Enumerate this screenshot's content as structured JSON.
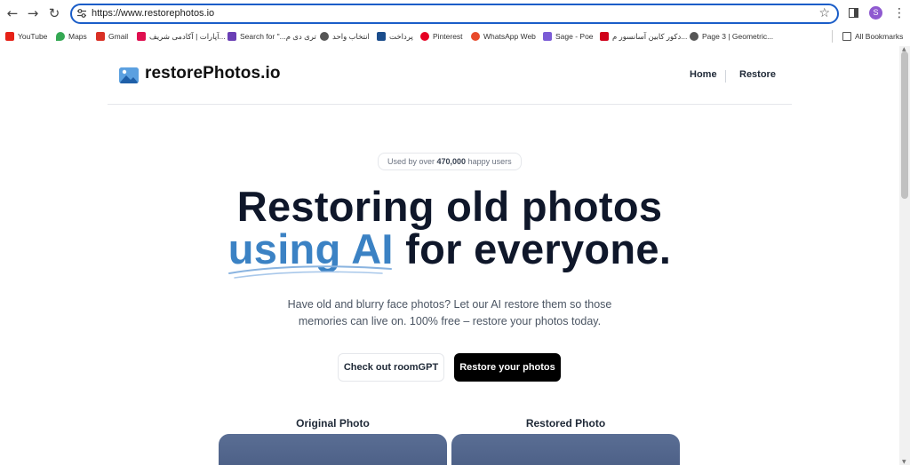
{
  "browser": {
    "url": "https://www.restorephotos.io",
    "profile_initial": "S"
  },
  "bookmarks": [
    {
      "label": "YouTube",
      "icon": "youtube-icon",
      "color": "#e62117"
    },
    {
      "label": "Maps",
      "icon": "maps-icon",
      "color": "#34a853"
    },
    {
      "label": "Gmail",
      "icon": "gmail-icon",
      "color": "#d93025"
    },
    {
      "label": "آپارات | آکادمی شریف...",
      "icon": "aparat-icon",
      "color": "#df0f50"
    },
    {
      "label": "Search for \"...تری دی م",
      "icon": "search-for-icon",
      "color": "#6a3fb5"
    },
    {
      "label": "انتخاب واحد",
      "icon": "globe-icon",
      "color": "#555555"
    },
    {
      "label": "پرداخت",
      "icon": "university-icon",
      "color": "#1b4d8c"
    },
    {
      "label": "Pinterest",
      "icon": "pinterest-icon",
      "color": "#e60023"
    },
    {
      "label": "WhatsApp Web",
      "icon": "whatsapp-icon",
      "color": "#e8492a"
    },
    {
      "label": "Sage - Poe",
      "icon": "poe-icon",
      "color": "#7b5cd6"
    },
    {
      "label": "دکور کابین آسانسور م...",
      "icon": "decor-icon",
      "color": "#d0021b"
    },
    {
      "label": "Page 3 | Geometric...",
      "icon": "globe-icon",
      "color": "#555555"
    }
  ],
  "all_bookmarks": "All Bookmarks",
  "site": {
    "logo_text": "restorePhotos.io",
    "nav": {
      "home": "Home",
      "restore": "Restore"
    },
    "badge_prefix": "Used by over ",
    "badge_count": "470,000",
    "badge_suffix": " happy users",
    "hero_line1": "Restoring old photos",
    "hero_accent": "using AI",
    "hero_line2_rest": " for everyone.",
    "subtitle_line1": "Have old and blurry face photos? Let our AI restore them so those",
    "subtitle_line2": "memories can live on. 100% free – restore your photos today.",
    "btn_secondary": "Check out roomGPT",
    "btn_primary": "Restore your photos",
    "original_label": "Original Photo",
    "restored_label": "Restored Photo",
    "accent_color": "#3b82c4"
  }
}
